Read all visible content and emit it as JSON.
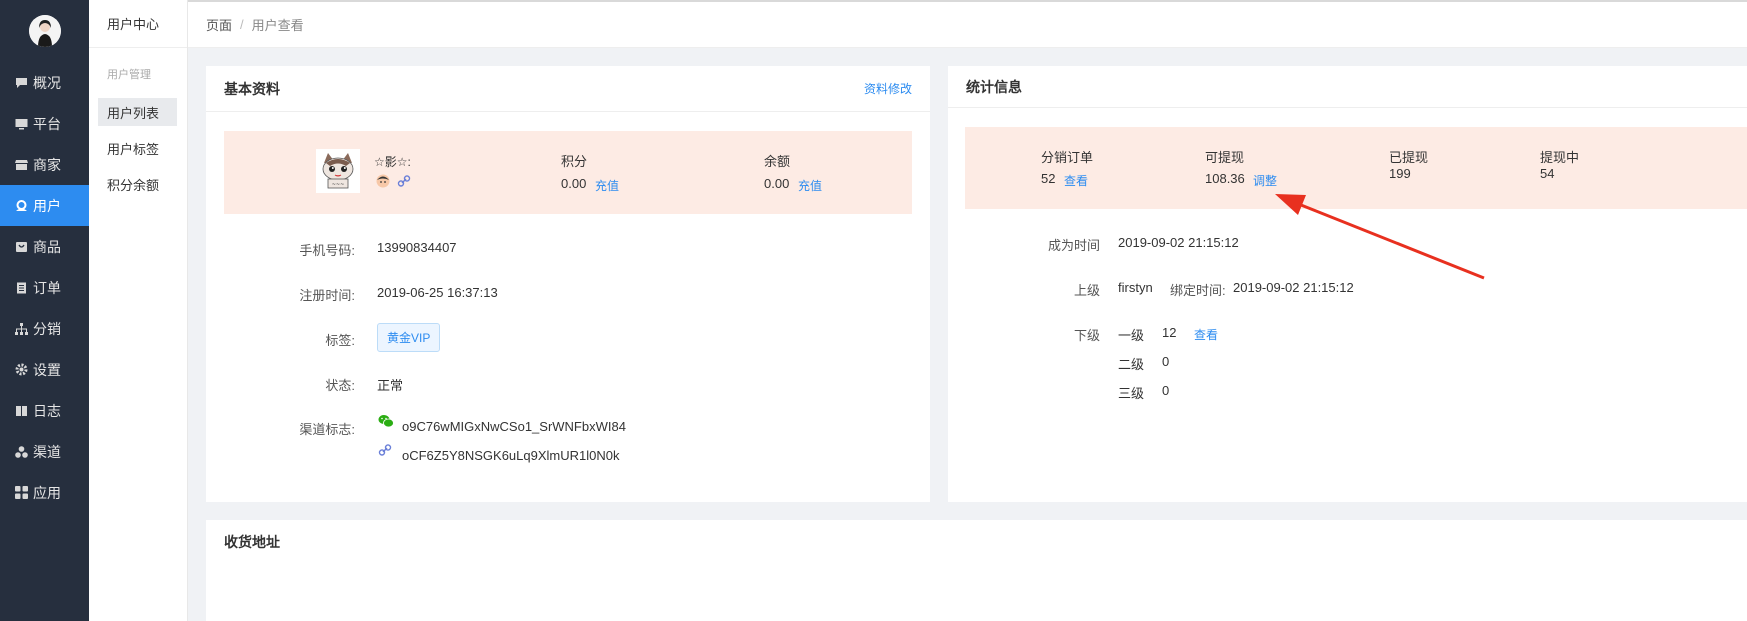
{
  "sidebar": {
    "items": [
      {
        "label": "概况",
        "icon": "chat-icon"
      },
      {
        "label": "平台",
        "icon": "monitor-icon"
      },
      {
        "label": "商家",
        "icon": "store-icon"
      },
      {
        "label": "用户",
        "icon": "user-icon",
        "active": true
      },
      {
        "label": "商品",
        "icon": "bag-icon"
      },
      {
        "label": "订单",
        "icon": "clipboard-icon"
      },
      {
        "label": "分销",
        "icon": "sitemap-icon"
      },
      {
        "label": "设置",
        "icon": "gear-icon"
      },
      {
        "label": "日志",
        "icon": "book-icon"
      },
      {
        "label": "渠道",
        "icon": "cluster-icon"
      },
      {
        "label": "应用",
        "icon": "grid-icon"
      }
    ]
  },
  "submenu": {
    "title": "用户中心",
    "group": "用户管理",
    "items": [
      "用户列表",
      "用户标签",
      "积分余额"
    ]
  },
  "breadcrumb": {
    "root": "页面",
    "separator": "/",
    "current": "用户查看"
  },
  "profile": {
    "title": "基本资料",
    "edit_link": "资料修改",
    "nickname": "☆影☆:",
    "points_label": "积分",
    "points_value": "0.00",
    "points_recharge": "充值",
    "balance_label": "余额",
    "balance_value": "0.00",
    "balance_recharge": "充值",
    "fields": {
      "phone_label": "手机号码:",
      "phone_value": "13990834407",
      "register_label": "注册时间:",
      "register_value": "2019-06-25 16:37:13",
      "tag_label": "标签:",
      "tag_value": "黄金VIP",
      "status_label": "状态:",
      "status_value": "正常",
      "channel_label": "渠道标志:",
      "channel_wechat": "o9C76wMIGxNwCSo1_SrWNFbxWI84",
      "channel_link": "oCF6Z5Y8NSGK6uLq9XlmUR1l0N0k"
    }
  },
  "stats": {
    "title": "统计信息",
    "orders_label": "分销订单",
    "orders_value": "52",
    "orders_link": "查看",
    "withdrawable_label": "可提现",
    "withdrawable_value": "108.36",
    "withdrawable_link": "调整",
    "withdrawn_label": "已提现",
    "withdrawn_value": "199",
    "withdrawing_label": "提现中",
    "withdrawing_value": "54",
    "become_label": "成为时间",
    "become_value": "2019-09-02 21:15:12",
    "parent_label": "上级",
    "parent_value": "firstyn",
    "bind_label": "绑定时间:",
    "bind_value": "2019-09-02 21:15:12",
    "children_label": "下级",
    "level1_label": "一级",
    "level1_value": "12",
    "level1_link": "查看",
    "level2_label": "二级",
    "level2_value": "0",
    "level3_label": "三级",
    "level3_value": "0"
  },
  "address": {
    "title": "收货地址"
  },
  "colors": {
    "sidebar_bg": "#262f3e",
    "active_blue": "#2d8cf0",
    "highlight_bg": "#fdebe4",
    "arrow_red": "#e8301f"
  }
}
